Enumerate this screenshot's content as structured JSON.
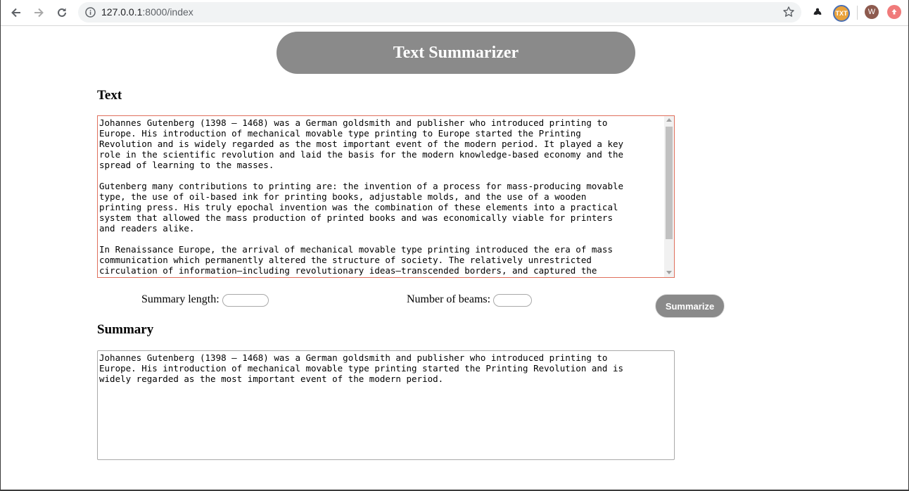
{
  "browser": {
    "url_host": "127.0.0.1",
    "url_rest": ":8000/index",
    "extensions": [
      {
        "name": "puzzle-extension-icon",
        "label": ""
      },
      {
        "name": "txt-extension-icon",
        "label": "TXT"
      },
      {
        "name": "profile-avatar",
        "label": "W"
      },
      {
        "name": "update-icon",
        "label": ""
      }
    ]
  },
  "page": {
    "title": "Text Summarizer",
    "text_label": "Text",
    "input_text": "Johannes Gutenberg (1398 – 1468) was a German goldsmith and publisher who introduced printing to\nEurope. His introduction of mechanical movable type printing to Europe started the Printing\nRevolution and is widely regarded as the most important event of the modern period. It played a key\nrole in the scientific revolution and laid the basis for the modern knowledge-based economy and the\nspread of learning to the masses.\n\nGutenberg many contributions to printing are: the invention of a process for mass-producing movable\ntype, the use of oil-based ink for printing books, adjustable molds, and the use of a wooden\nprinting press. His truly epochal invention was the combination of these elements into a practical\nsystem that allowed the mass production of printed books and was economically viable for printers\nand readers alike.\n\nIn Renaissance Europe, the arrival of mechanical movable type printing introduced the era of mass\ncommunication which permanently altered the structure of society. The relatively unrestricted\ncirculation of information—including revolutionary ideas—transcended borders, and captured the",
    "summary_length_label": "Summary length:",
    "summary_length_value": "",
    "beams_label": "Number of beams:",
    "beams_value": "",
    "summarize_button": "Summarize",
    "summary_label": "Summary",
    "summary_text": "Johannes Gutenberg (1398 – 1468) was a German goldsmith and publisher who introduced printing to\nEurope. His introduction of mechanical movable type printing started the Printing Revolution and is\nwidely regarded as the most important event of the modern period."
  }
}
